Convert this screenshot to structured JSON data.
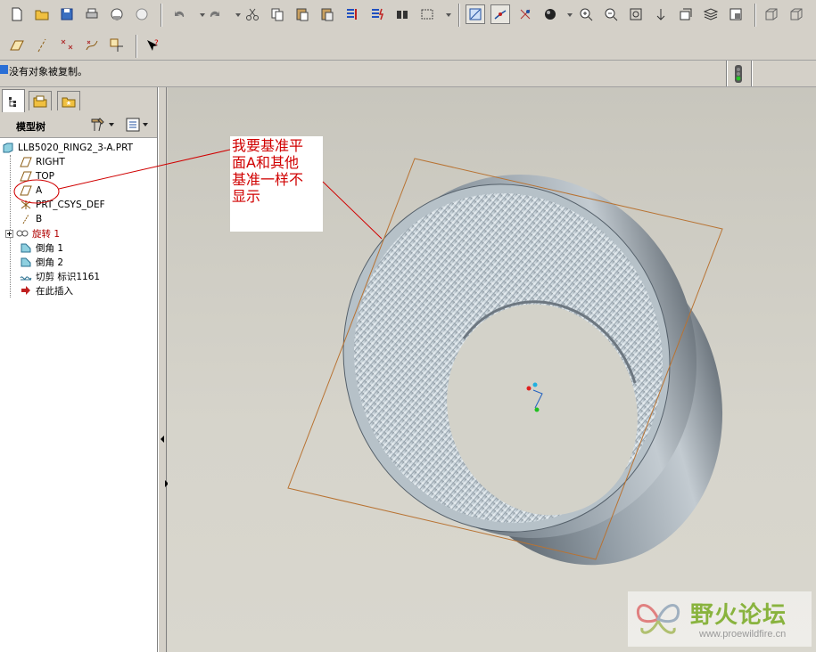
{
  "message_bar": {
    "text": "没有对象被复制。"
  },
  "panel": {
    "title": "模型树"
  },
  "tree": {
    "root": "LLB5020_RING2_3-A.PRT",
    "items": [
      {
        "label": "RIGHT",
        "icon": "datum-plane-icon"
      },
      {
        "label": "TOP",
        "icon": "datum-plane-icon"
      },
      {
        "label": "A",
        "icon": "datum-plane-icon"
      },
      {
        "label": "PRT_CSYS_DEF",
        "icon": "csys-icon"
      },
      {
        "label": "B",
        "icon": "datum-axis-icon"
      },
      {
        "label": "旋转 1",
        "icon": "revolve-icon"
      },
      {
        "label": "倒角 1",
        "icon": "chamfer-icon"
      },
      {
        "label": "倒角 2",
        "icon": "chamfer-icon"
      },
      {
        "label": "切剪 标识1161",
        "icon": "cut-icon"
      },
      {
        "label": "在此插入",
        "icon": "insert-here-icon"
      }
    ]
  },
  "annotation": {
    "lines": [
      "我要基准平",
      "面A和其他",
      "基准一样不",
      "显示"
    ]
  },
  "watermark": {
    "title": "野火论坛",
    "url": "www.proewildfire.cn"
  },
  "colors": {
    "annotation": "#d00000",
    "datum_plane": "#b87333",
    "ring": "#8f9aa3"
  }
}
